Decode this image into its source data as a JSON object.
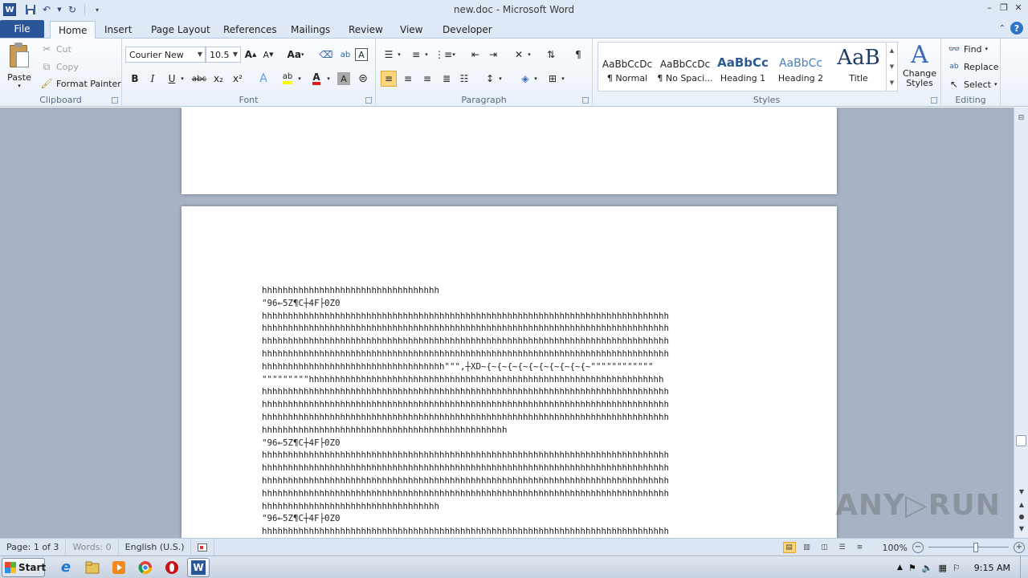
{
  "window": {
    "title": "new.doc - Microsoft Word",
    "app_icon_letter": "W"
  },
  "qat": {
    "items": [
      "save-icon",
      "undo-icon",
      "redo-icon",
      "customize-icon"
    ]
  },
  "tabs": [
    "File",
    "Home",
    "Insert",
    "Page Layout",
    "References",
    "Mailings",
    "Review",
    "View",
    "Developer"
  ],
  "active_tab": "Home",
  "clipboard": {
    "paste": "Paste",
    "cut": "Cut",
    "copy": "Copy",
    "format_painter": "Format Painter",
    "label": "Clipboard"
  },
  "font": {
    "name": "Courier New",
    "size": "10.5",
    "label": "Font",
    "grow": "A",
    "shrink": "A",
    "case": "Aa",
    "bold": "B",
    "italic": "I",
    "underline": "U",
    "strike": "abc",
    "subscript": "x₂",
    "superscript": "x²",
    "text_effects": "A",
    "font_color": "A",
    "highlight_color": "#ffff00",
    "font_color_value": "#e02020"
  },
  "paragraph": {
    "label": "Paragraph",
    "show_marks": "¶"
  },
  "styles": {
    "label": "Styles",
    "items": [
      {
        "preview": "AaBbCcDc",
        "name": "¶ Normal"
      },
      {
        "preview": "AaBbCcDc",
        "name": "¶ No Spaci..."
      },
      {
        "preview": "AaBbCc",
        "name": "Heading 1"
      },
      {
        "preview": "AaBbCc",
        "name": "Heading 2"
      },
      {
        "preview": "AaB",
        "name": "Title"
      }
    ],
    "change_styles": "Change Styles"
  },
  "editing": {
    "label": "Editing",
    "find": "Find",
    "replace": "Replace",
    "select": "Select"
  },
  "document": {
    "lines": [
      "hhhhhhhhhhhhhhhhhhhhhhhhhhhhhhhhhh",
      "\"96←5Z¶C┼4F├0Z0",
      "hhhhhhhhhhhhhhhhhhhhhhhhhhhhhhhhhhhhhhhhhhhhhhhhhhhhhhhhhhhhhhhhhhhhhhhhhhhhhh",
      "hhhhhhhhhhhhhhhhhhhhhhhhhhhhhhhhhhhhhhhhhhhhhhhhhhhhhhhhhhhhhhhhhhhhhhhhhhhhhh",
      "hhhhhhhhhhhhhhhhhhhhhhhhhhhhhhhhhhhhhhhhhhhhhhhhhhhhhhhhhhhhhhhhhhhhhhhhhhhhhh",
      "hhhhhhhhhhhhhhhhhhhhhhhhhhhhhhhhhhhhhhhhhhhhhhhhhhhhhhhhhhhhhhhhhhhhhhhhhhhhhh",
      "hhhhhhhhhhhhhhhhhhhhhhhhhhhhhhhhhhh\"\"\",┼XD~{~{~{~{~{~{~{~{~{~{~\"\"\"\"\"\"\"\"\"\"\"\"",
      "\"\"\"\"\"\"\"\"\"hhhhhhhhhhhhhhhhhhhhhhhhhhhhhhhhhhhhhhhhhhhhhhhhhhhhhhhhhhhhhhhhhhhh",
      "hhhhhhhhhhhhhhhhhhhhhhhhhhhhhhhhhhhhhhhhhhhhhhhhhhhhhhhhhhhhhhhhhhhhhhhhhhhhhh",
      "hhhhhhhhhhhhhhhhhhhhhhhhhhhhhhhhhhhhhhhhhhhhhhhhhhhhhhhhhhhhhhhhhhhhhhhhhhhhhh",
      "hhhhhhhhhhhhhhhhhhhhhhhhhhhhhhhhhhhhhhhhhhhhhhhhhhhhhhhhhhhhhhhhhhhhhhhhhhhhhh",
      "hhhhhhhhhhhhhhhhhhhhhhhhhhhhhhhhhhhhhhhhhhhhhhh",
      "\"96←5Z¶C┼4F├0Z0",
      "hhhhhhhhhhhhhhhhhhhhhhhhhhhhhhhhhhhhhhhhhhhhhhhhhhhhhhhhhhhhhhhhhhhhhhhhhhhhhh",
      "hhhhhhhhhhhhhhhhhhhhhhhhhhhhhhhhhhhhhhhhhhhhhhhhhhhhhhhhhhhhhhhhhhhhhhhhhhhhhh",
      "hhhhhhhhhhhhhhhhhhhhhhhhhhhhhhhhhhhhhhhhhhhhhhhhhhhhhhhhhhhhhhhhhhhhhhhhhhhhhh",
      "hhhhhhhhhhhhhhhhhhhhhhhhhhhhhhhhhhhhhhhhhhhhhhhhhhhhhhhhhhhhhhhhhhhhhhhhhhhhhh",
      "hhhhhhhhhhhhhhhhhhhhhhhhhhhhhhhhhh",
      "\"96←5Z¶C┼4F├0Z0",
      "hhhhhhhhhhhhhhhhhhhhhhhhhhhhhhhhhhhhhhhhhhhhhhhhhhhhhhhhhhhhhhhhhhhhhhhhhhhhhh"
    ]
  },
  "watermark": "ANY▷RUN",
  "status": {
    "page": "Page: 1 of 3",
    "words": "Words: 0",
    "language": "English (U.S.)",
    "zoom": "100%",
    "zoom_minus": "−",
    "zoom_plus": "+"
  },
  "taskbar": {
    "start": "Start",
    "apps": [
      "ie-icon",
      "explorer-icon",
      "media-player-icon",
      "chrome-icon",
      "opera-icon",
      "word-icon"
    ],
    "clock": "9:15 AM"
  }
}
